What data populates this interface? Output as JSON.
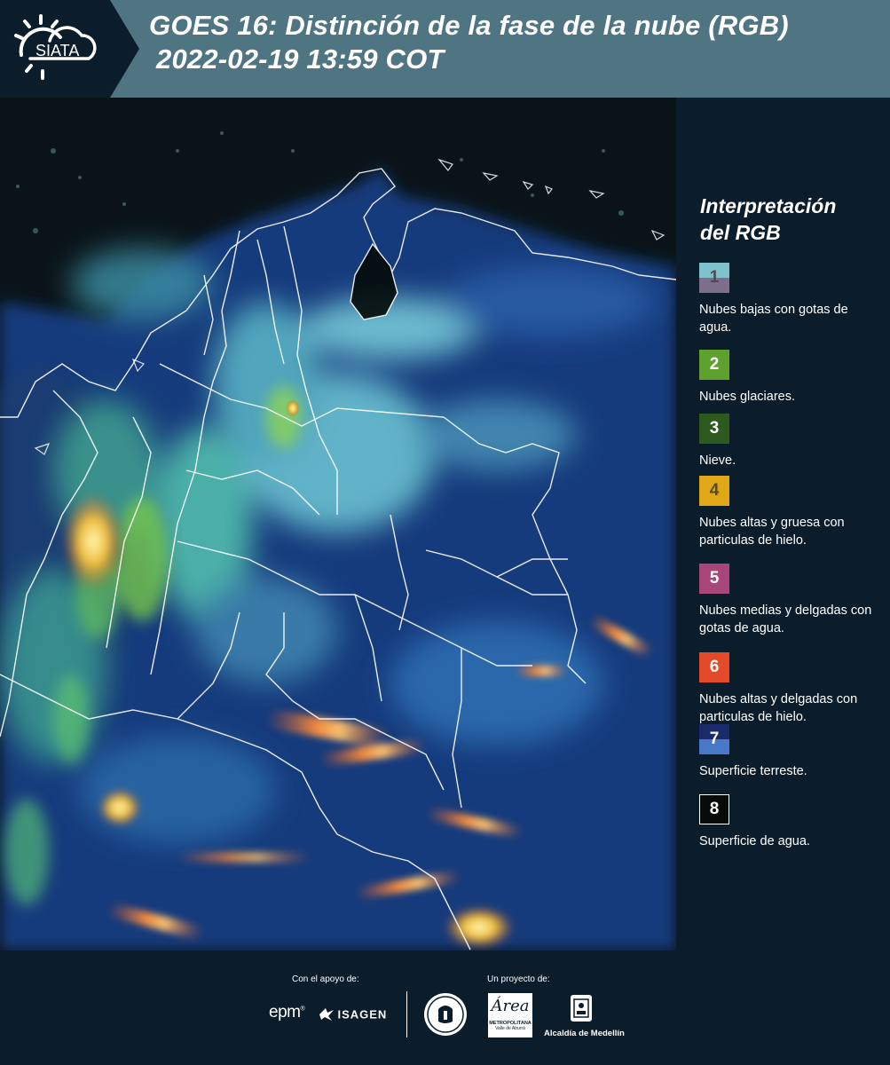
{
  "header": {
    "logo_text": "SIATA",
    "title_line1": "GOES 16: Distinción de la fase de la nube (RGB)",
    "title_line2": "2022-02-19 13:59 COT"
  },
  "legend": {
    "title_line1": "Interpretación",
    "title_line2": "del RGB",
    "items": [
      {
        "number": "1",
        "label": "Nubes bajas con gotas de agua.",
        "color_top": "#7fc2cc",
        "color_bottom": "#7d6e8c",
        "number_color": "#4a4a5a"
      },
      {
        "number": "2",
        "label": "Nubes glaciares.",
        "color": "#5ea12f",
        "number_color": "#ffffff"
      },
      {
        "number": "3",
        "label": "Nieve.",
        "color": "#2d5a1e",
        "number_color": "#ffffff"
      },
      {
        "number": "4",
        "label": "Nubes altas y gruesa con particulas de hielo.",
        "color": "#e0a818",
        "number_color": "#5a4a20"
      },
      {
        "number": "5",
        "label": "Nubes medias y delgadas con gotas de agua.",
        "color": "#a8467a",
        "number_color": "#ffffff"
      },
      {
        "number": "6",
        "label": "Nubes altas y delgadas con particulas de hielo.",
        "color": "#e24a2a",
        "number_color": "#ffffff"
      },
      {
        "number": "7",
        "label": "Superficie terreste.",
        "color_top": "#1a2a6a",
        "color_bottom": "#4a78c8",
        "number_color": "#ffffff"
      },
      {
        "number": "8",
        "label": "Superficie de agua.",
        "color": "#050c08",
        "border": "#ffffff",
        "number_color": "#ffffff"
      }
    ]
  },
  "footer": {
    "support_label": "Con el apoyo de:",
    "project_label": "Un proyecto de:",
    "sponsor_epm": "epm",
    "sponsor_isagen": "ISAGEN",
    "metro_logo_text": "Área",
    "metro_label_1": "METROPOLITANA",
    "metro_label_2": "Valle de Aburrá",
    "alcaldia_label": "Alcaldía de Medellín"
  }
}
